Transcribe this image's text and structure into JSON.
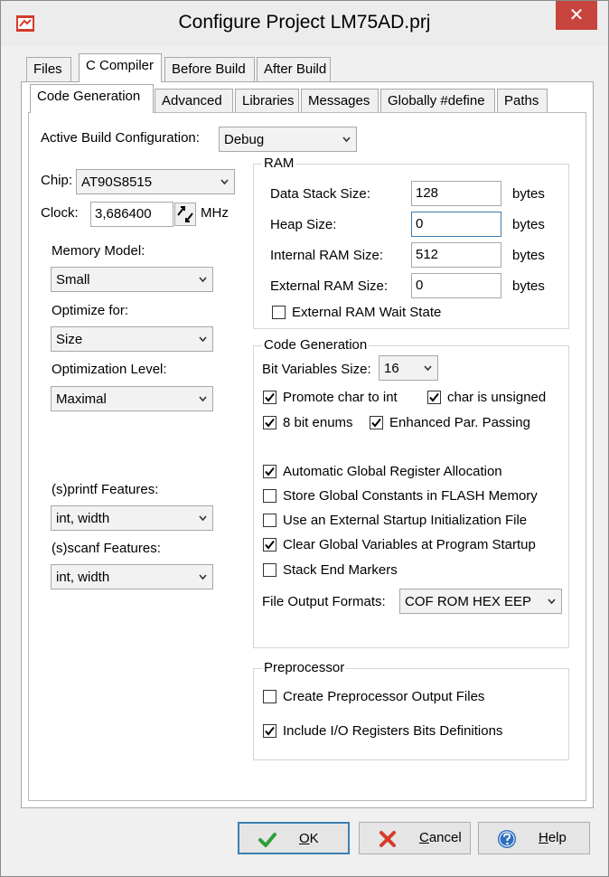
{
  "window": {
    "title": "Configure Project LM75AD.prj",
    "close_glyph": "✕"
  },
  "main_tabs": [
    {
      "label": "Files"
    },
    {
      "label": "C Compiler"
    },
    {
      "label": "Before Build"
    },
    {
      "label": "After Build"
    }
  ],
  "sub_tabs": [
    {
      "label": "Code Generation"
    },
    {
      "label": "Advanced"
    },
    {
      "label": "Libraries"
    },
    {
      "label": "Messages"
    },
    {
      "label": "Globally #define"
    },
    {
      "label": "Paths"
    }
  ],
  "build_config": {
    "label": "Active Build Configuration:",
    "value": "Debug"
  },
  "chip": {
    "label": "Chip:",
    "value": "AT90S8515"
  },
  "clock": {
    "label": "Clock:",
    "value": "3,686400",
    "unit": "MHz"
  },
  "memory_model": {
    "label": "Memory Model:",
    "value": "Small"
  },
  "optimize_for": {
    "label": "Optimize for:",
    "value": "Size"
  },
  "optimization_level": {
    "label": "Optimization Level:",
    "value": "Maximal"
  },
  "printf_features": {
    "label": "(s)printf Features:",
    "value": "int, width"
  },
  "scanf_features": {
    "label": "(s)scanf Features:",
    "value": "int, width"
  },
  "ram": {
    "title": "RAM",
    "data_stack": {
      "label": "Data Stack Size:",
      "value": "128",
      "unit": "bytes"
    },
    "heap": {
      "label": "Heap Size:",
      "value": "0",
      "unit": "bytes"
    },
    "internal_ram": {
      "label": "Internal RAM Size:",
      "value": "512",
      "unit": "bytes"
    },
    "external_ram": {
      "label": "External RAM Size:",
      "value": "0",
      "unit": "bytes"
    },
    "wait_state": {
      "label": "External RAM Wait State",
      "checked": false
    }
  },
  "code_gen": {
    "title": "Code Generation",
    "bit_vars": {
      "label": "Bit Variables Size:",
      "value": "16"
    },
    "promote_char": {
      "label": "Promote char to int",
      "checked": true
    },
    "char_unsigned": {
      "label": "char is unsigned",
      "checked": true
    },
    "enums_8bit": {
      "label": "8 bit enums",
      "checked": true
    },
    "enhanced_par": {
      "label": "Enhanced Par. Passing",
      "checked": true
    },
    "auto_global_reg": {
      "label": "Automatic Global Register Allocation",
      "checked": true
    },
    "store_consts_flash": {
      "label": "Store Global Constants in FLASH Memory",
      "checked": false
    },
    "external_startup": {
      "label": "Use an External Startup Initialization File",
      "checked": false
    },
    "clear_globals": {
      "label": "Clear Global Variables at Program Startup",
      "checked": true
    },
    "stack_end": {
      "label": "Stack End Markers",
      "checked": false
    },
    "file_output": {
      "label": "File Output Formats:",
      "value": "COF ROM HEX EEP"
    }
  },
  "preprocessor": {
    "title": "Preprocessor",
    "create_output": {
      "label": "Create Preprocessor Output Files",
      "checked": false
    },
    "include_io": {
      "label": "Include I/O Registers Bits Definitions",
      "checked": true
    }
  },
  "buttons": {
    "ok": {
      "underline": "O",
      "rest": "K"
    },
    "cancel": {
      "underline": "C",
      "rest": "ancel"
    },
    "help": {
      "underline": "H",
      "rest": "elp"
    }
  },
  "colors": {
    "accent": "#3c7fb1",
    "check_green": "#2e9e3a",
    "cancel_red": "#d83b2a",
    "close_red": "#c7453e",
    "help_blue": "#2f6fbf"
  }
}
